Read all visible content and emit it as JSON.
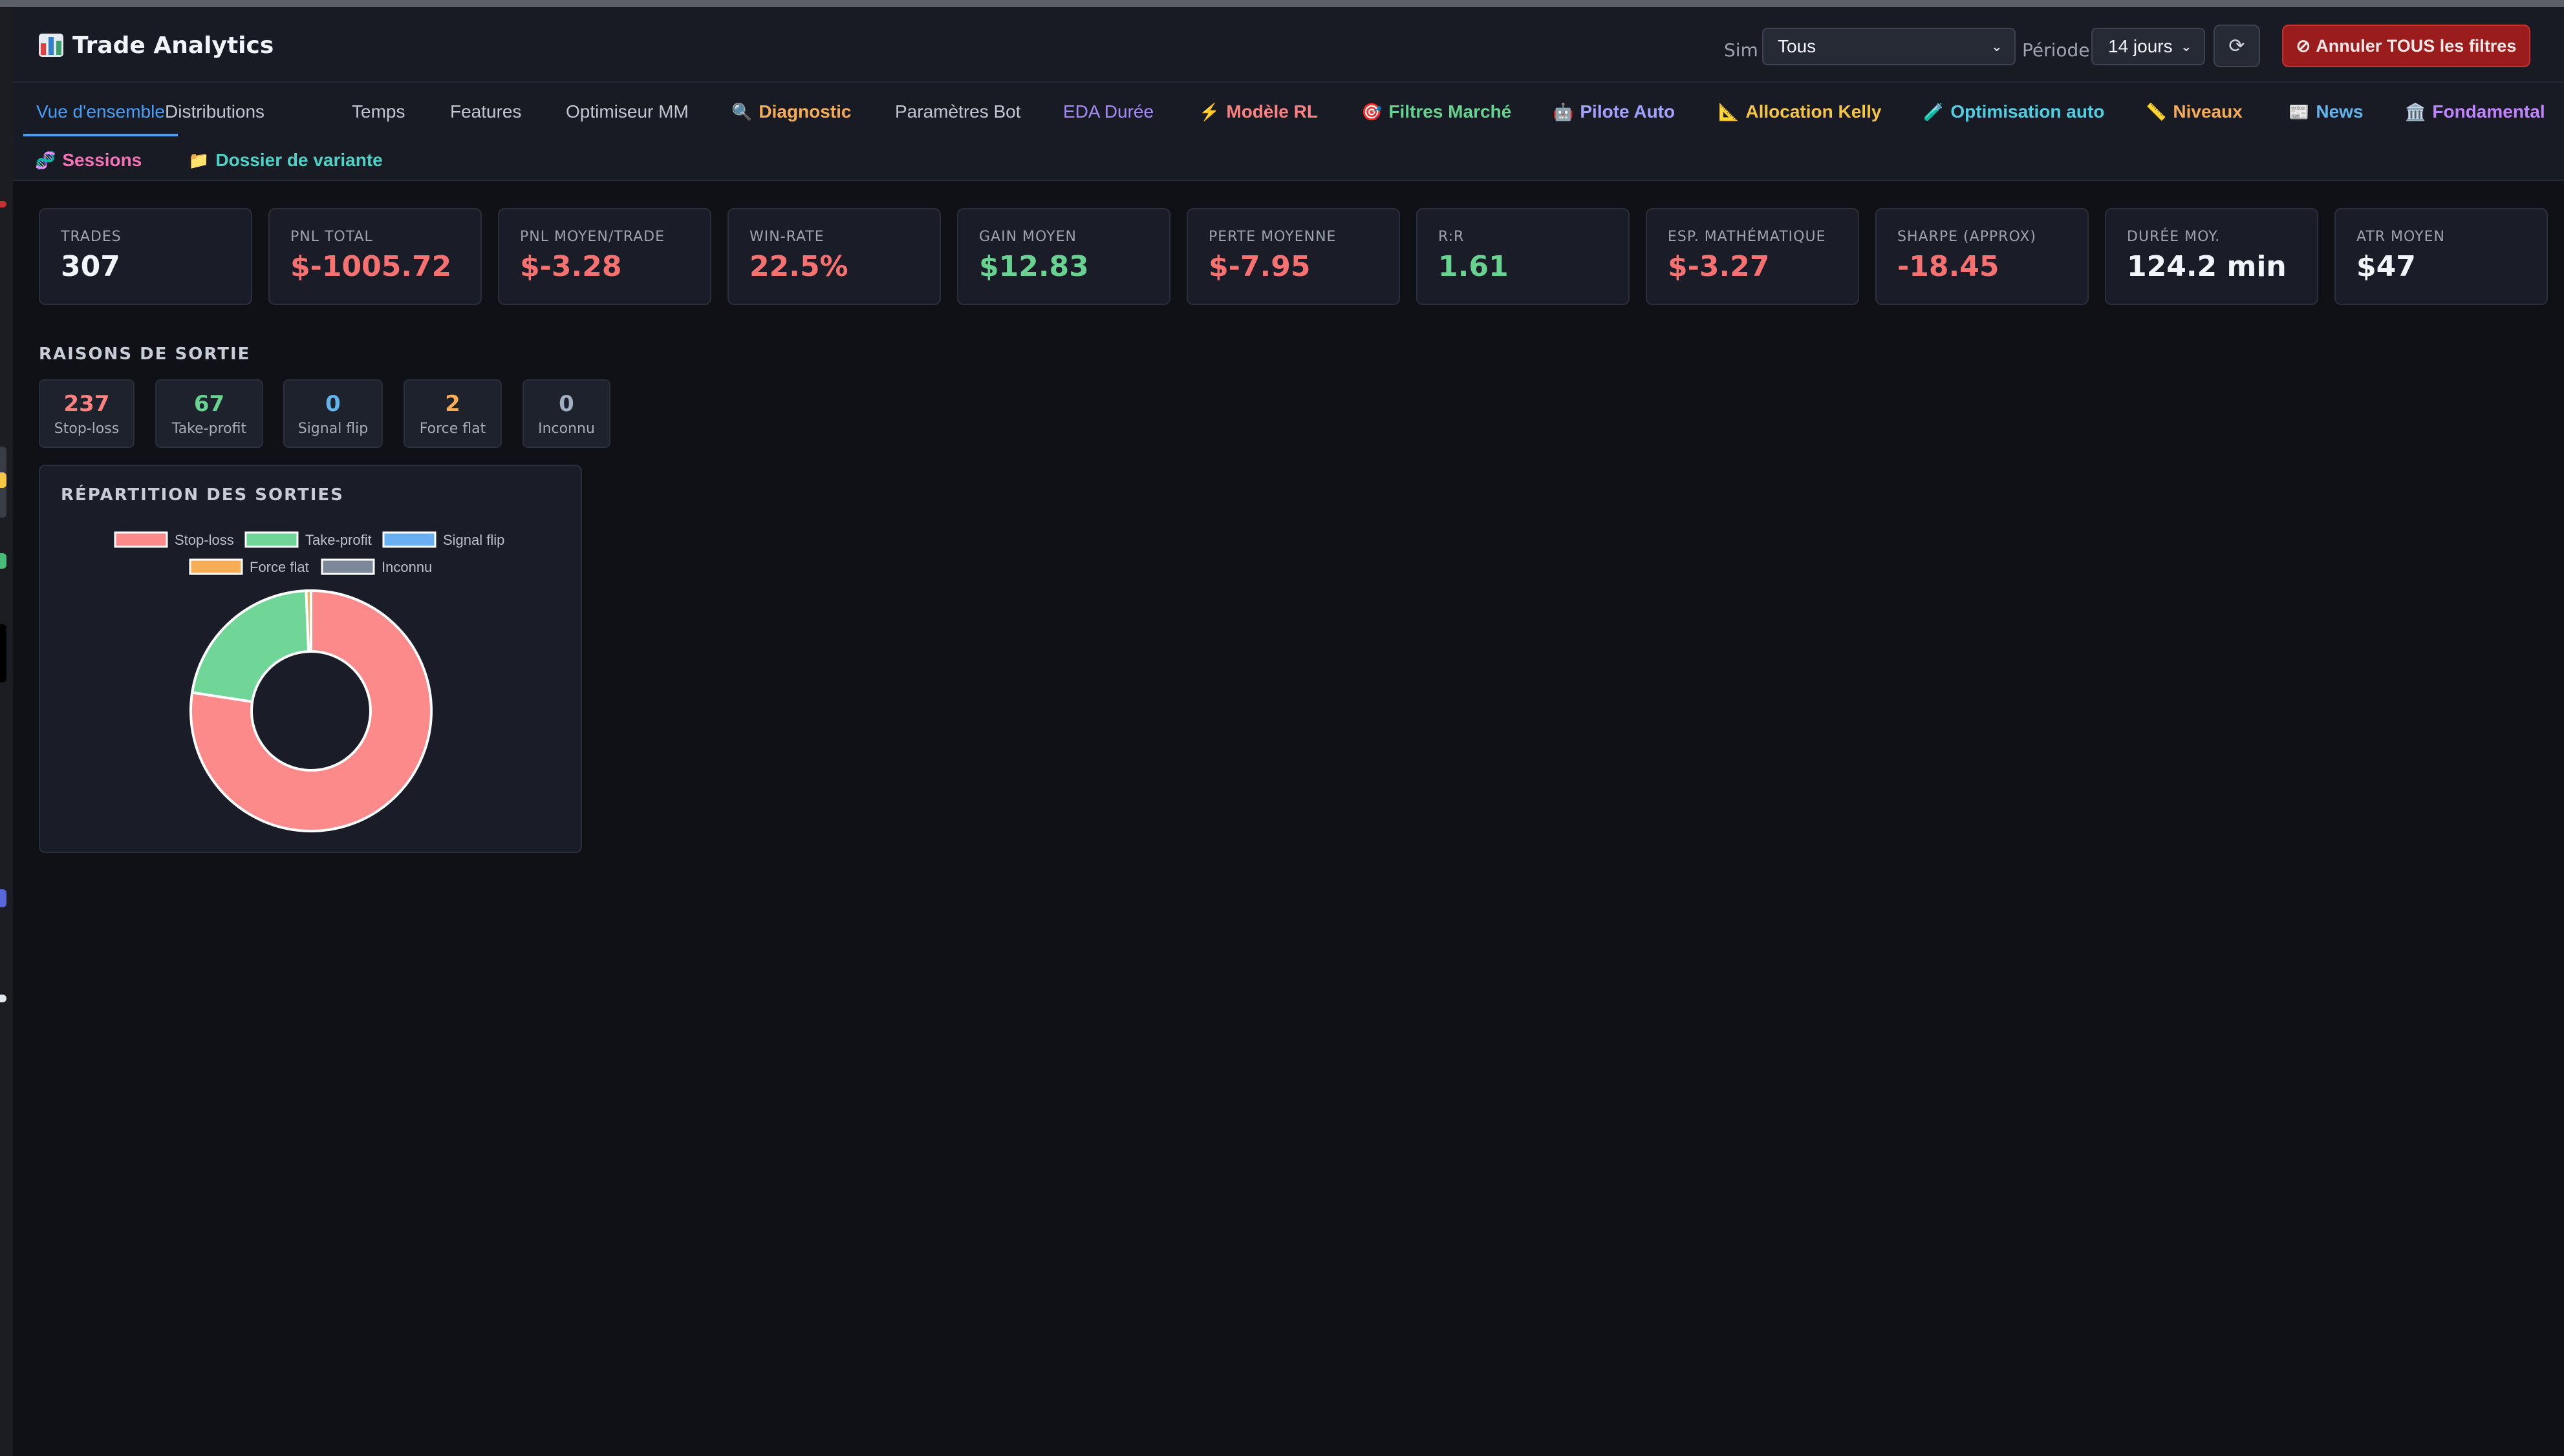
{
  "app": {
    "title": "Trade Analytics"
  },
  "filters": {
    "sim_label": "Sim",
    "sim_value": "Tous",
    "period_label": "Période",
    "period_value": "14 jours",
    "refresh_glyph": "⟳",
    "cancel_label": "Annuler TOUS les filtres",
    "cancel_glyph": "⊘"
  },
  "tabs": [
    {
      "label": "Vue d'ensemble",
      "icon": "",
      "color": "#4a9ff5"
    },
    {
      "label": "Distributions",
      "icon": "",
      "color": "#c1c6d0"
    },
    {
      "label": "Temps",
      "icon": "",
      "color": "#c1c6d0"
    },
    {
      "label": "Features",
      "icon": "",
      "color": "#c1c6d0"
    },
    {
      "label": "Optimiseur MM",
      "icon": "",
      "color": "#c1c6d0"
    },
    {
      "label": "Diagnostic",
      "icon": "🔍",
      "color": "#f6ad55"
    },
    {
      "label": "Paramètres Bot",
      "icon": "",
      "color": "#c1c6d0"
    },
    {
      "label": "EDA Durée",
      "icon": "",
      "color": "#a78bfa"
    },
    {
      "label": "Modèle RL",
      "icon": "⚡",
      "color": "#fc8181"
    },
    {
      "label": "Filtres Marché",
      "icon": "🎯",
      "color": "#68d391"
    },
    {
      "label": "Pilote Auto",
      "icon": "🤖",
      "color": "#a3a3ff"
    },
    {
      "label": "Allocation Kelly",
      "icon": "📐",
      "color": "#f6c744"
    },
    {
      "label": "Optimisation auto",
      "icon": "🧪",
      "color": "#4fd1e5"
    },
    {
      "label": "Niveaux",
      "icon": "📏",
      "color": "#f6ad55"
    },
    {
      "label": "News",
      "icon": "📰",
      "color": "#63b3ed"
    },
    {
      "label": "Fondamental",
      "icon": "🏛️",
      "color": "#c084fc"
    },
    {
      "label": "Sessions",
      "icon": "🧬",
      "color": "#f472b6"
    },
    {
      "label": "Dossier de variante",
      "icon": "📁",
      "color": "#4fd1c5"
    }
  ],
  "kpis": [
    {
      "label": "TRADES",
      "value": "307",
      "color": "#f1f5f9"
    },
    {
      "label": "PNL TOTAL",
      "value": "$-1005.72",
      "color": "#f87171"
    },
    {
      "label": "PNL MOYEN/TRADE",
      "value": "$-3.28",
      "color": "#f87171"
    },
    {
      "label": "WIN-RATE",
      "value": "22.5%",
      "color": "#f87171"
    },
    {
      "label": "GAIN MOYEN",
      "value": "$12.83",
      "color": "#68d391"
    },
    {
      "label": "PERTE MOYENNE",
      "value": "$-7.95",
      "color": "#f87171"
    },
    {
      "label": "R:R",
      "value": "1.61",
      "color": "#68d391"
    },
    {
      "label": "ESP. MATHÉMATIQUE",
      "value": "$-3.27",
      "color": "#f87171"
    },
    {
      "label": "SHARPE (APPROX)",
      "value": "-18.45",
      "color": "#f87171"
    },
    {
      "label": "DURÉE MOY.",
      "value": "124.2 min",
      "color": "#f1f5f9"
    },
    {
      "label": "ATR MOYEN",
      "value": "$47",
      "color": "#f1f5f9"
    }
  ],
  "exit_reasons": {
    "title": "RAISONS DE SORTIE",
    "items": [
      {
        "count": "237",
        "label": "Stop-loss",
        "color": "#fc8181"
      },
      {
        "count": "67",
        "label": "Take-profit",
        "color": "#68d391"
      },
      {
        "count": "0",
        "label": "Signal flip",
        "color": "#63b3ed"
      },
      {
        "count": "2",
        "label": "Force flat",
        "color": "#f6ad55"
      },
      {
        "count": "0",
        "label": "Inconnu",
        "color": "#a0aec0"
      }
    ]
  },
  "chart_data": {
    "type": "pie",
    "title": "RÉPARTITION DES SORTIES",
    "categories": [
      "Stop-loss",
      "Take-profit",
      "Signal flip",
      "Force flat",
      "Inconnu"
    ],
    "values": [
      237,
      67,
      0,
      2,
      0
    ],
    "colors": [
      "#fc8a8a",
      "#6fd698",
      "#6ab0f0",
      "#f6ad55",
      "#7c8799"
    ],
    "legend_placement": "top",
    "donut": true
  }
}
